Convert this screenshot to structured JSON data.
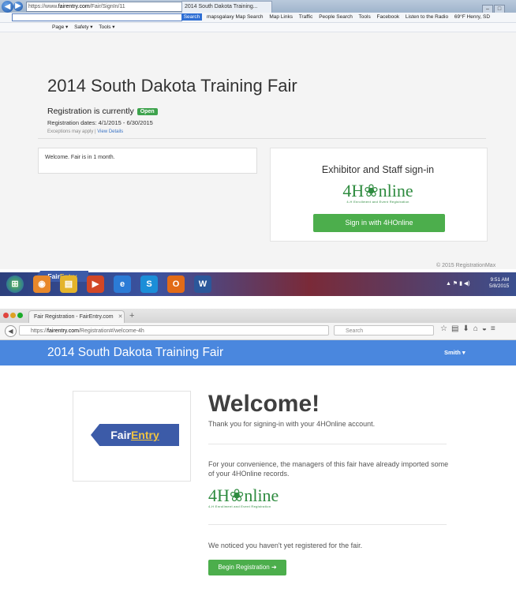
{
  "ie": {
    "url_prefix": "https://www.",
    "url_host": "fairentry.com",
    "url_path": "/Fair/SignIn/11",
    "tab_title": "2014 South Dakota Training...",
    "search_button": "Search",
    "toolbar_links": [
      "mapsgalaxy Map Search",
      "Map Links",
      "Traffic",
      "People Search",
      "Tools",
      "Facebook",
      "Listen to the Radio",
      "69°F Henry, SD"
    ],
    "command_bar": [
      "Page ▾",
      "Safety ▾",
      "Tools ▾"
    ]
  },
  "signin_page": {
    "title": "2014 South Dakota Training Fair",
    "registration_label": "Registration is currently",
    "registration_status": "Open",
    "registration_dates": "Registration dates: 4/1/2015 - 6/30/2015",
    "exceptions_text": "Exceptions may apply",
    "view_details": "View Details",
    "welcome_message": "Welcome. Fair is in 1 month.",
    "signin_heading": "Exhibitor and Staff sign-in",
    "signin_button": "Sign in with 4HOnline",
    "copyright": "© 2015 RegistrationMax",
    "fairentry_tab_1": "Fair",
    "fairentry_tab_2": "Entry"
  },
  "taskbar": {
    "time": "9:51 AM",
    "date": "5/8/2015"
  },
  "firefox": {
    "tab_title": "Fair Registration - FairEntry.com",
    "url_prefix": "https://",
    "url_host": "fairentry.com",
    "url_path": "/Registration#/welcome-4h",
    "search_placeholder": "Search"
  },
  "welcome_page": {
    "header_title": "2014 South Dakota Training Fair",
    "user_menu": "Smith ▾",
    "logo_text_1": "Fair",
    "logo_text_2": "Entry",
    "heading": "Welcome!",
    "thank_you": "Thank you for signing-in with your 4HOnline account.",
    "convenience": "For your convenience, the managers of this fair have already imported some of your 4HOnline records.",
    "noticed": "We noticed you haven't yet registered for the fair.",
    "begin_button": "Begin Registration"
  },
  "logo_4honline": {
    "brand_left": "4H",
    "brand_right": "nline",
    "tagline": "4-H Enrollment and Event Registration"
  },
  "colors": {
    "header_blue": "#4a87de",
    "button_green": "#4cae4c",
    "fairentry_blue": "#3c5ba8",
    "fairentry_gold": "#f0c341"
  }
}
